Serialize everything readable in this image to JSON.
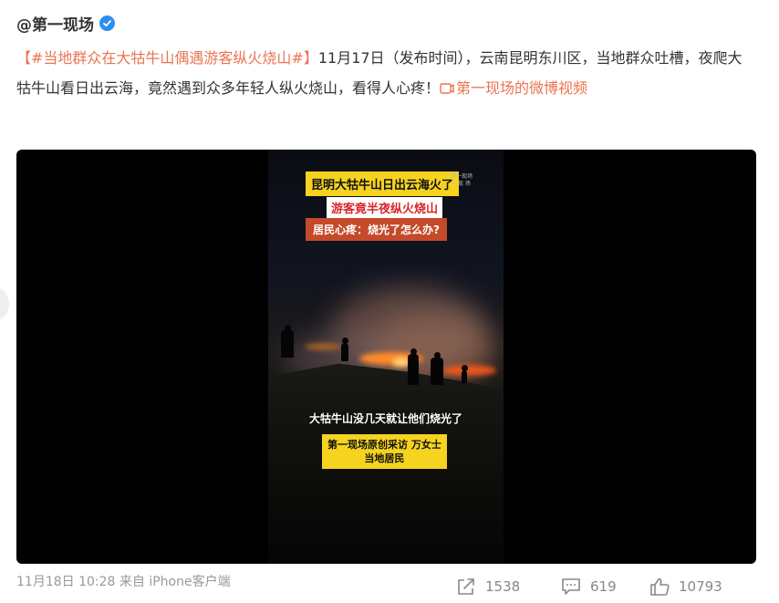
{
  "post": {
    "author": "@第一现场",
    "verified": true,
    "hashtag": "【#当地群众在大牯牛山偶遇游客纵火烧山#】",
    "body": "11月17日（发布时间），云南昆明东川区，当地群众吐槽，夜爬大牯牛山看日出云海，竟然遇到众多年轻人纵火烧山，看得人心疼！",
    "video_link": "第一现场的微博视频",
    "meta": "11月18日 10:28 来自 iPhone客户端"
  },
  "video": {
    "caption_title": "昆明大牯牛山日出云海火了",
    "caption_subtitle": "游客竟半夜纵火烧山",
    "caption_question": "居民心疼：烧光了怎么办?",
    "caption_quote": "大牯牛山没几天就让他们烧光了",
    "caption_source_line1": "第一现场原创采访 万女士",
    "caption_source_line2": "当地居民",
    "watermark_line1": "第一现场",
    "watermark_line2": "一 现 场"
  },
  "actions": {
    "repost_count": "1538",
    "comment_count": "619",
    "like_count": "10793"
  },
  "colors": {
    "link_orange": "#eb7350",
    "verified_blue": "#2d8ff0",
    "caption_yellow": "#f5d31f",
    "caption_red": "#c44a2a"
  }
}
